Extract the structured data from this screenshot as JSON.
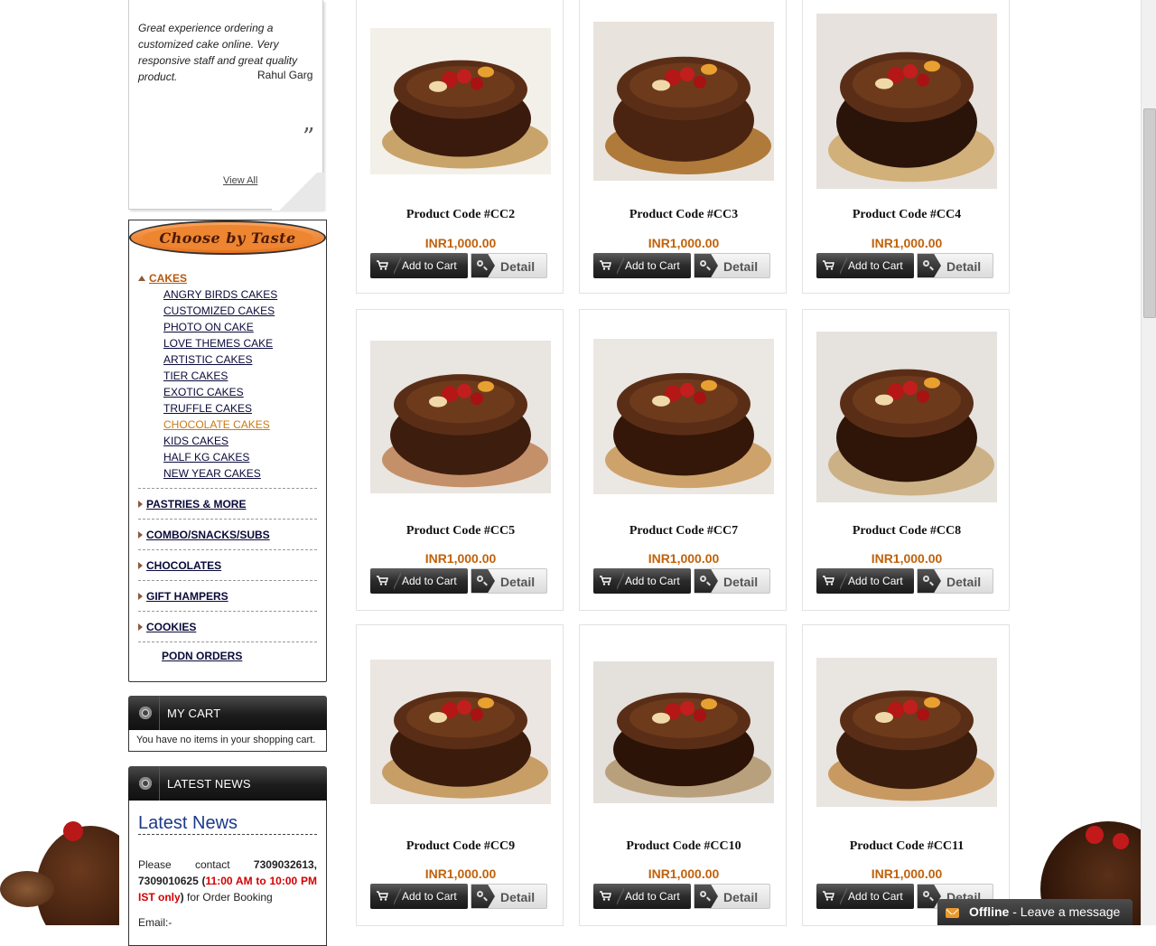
{
  "testimonial": {
    "text": "Great experience ordering a customized cake online. Very responsive staff and great quality product.",
    "author": "Rahul Garg",
    "view_all": "View All"
  },
  "taste": {
    "banner": "Choose by Taste",
    "categories": [
      {
        "label": "CAKES",
        "expanded": true,
        "subs": [
          "ANGRY BIRDS CAKES",
          "CUSTOMIZED CAKES",
          "PHOTO ON CAKE",
          "LOVE THEMES CAKE",
          "ARTISTIC CAKES",
          "TIER CAKES",
          "EXOTIC CAKES",
          "TRUFFLE CAKES",
          "CHOCOLATE CAKES",
          "KIDS CAKES",
          "HALF KG CAKES",
          "NEW YEAR CAKES"
        ],
        "current": "CHOCOLATE CAKES"
      },
      {
        "label": "PASTRIES & MORE"
      },
      {
        "label": "COMBO/SNACKS/SUBS"
      },
      {
        "label": "CHOCOLATES"
      },
      {
        "label": "GIFT HAMPERS"
      },
      {
        "label": "COOKIES"
      }
    ],
    "podn": "PODN ORDERS"
  },
  "cart": {
    "title": "MY CART",
    "empty_text": "You have no items in your shopping cart."
  },
  "news": {
    "header": "LATEST NEWS",
    "title": "Latest News",
    "contact_prefix": "Please contact",
    "phones": "7309032613, 7309010625",
    "hours_open": "(",
    "hours": "11:00 AM to 10:00 PM IST only",
    "hours_close": ")",
    "suffix": "for Order Booking",
    "email_label": "Email:-"
  },
  "buttons": {
    "add_to_cart": "Add to Cart",
    "detail": "Detail"
  },
  "products": [
    {
      "code": "Product Code #CC2",
      "price": "INR1,000.00"
    },
    {
      "code": "Product Code #CC3",
      "price": "INR1,000.00"
    },
    {
      "code": "Product Code #CC4",
      "price": "INR1,000.00"
    },
    {
      "code": "Product Code #CC5",
      "price": "INR1,000.00"
    },
    {
      "code": "Product Code #CC7",
      "price": "INR1,000.00"
    },
    {
      "code": "Product Code #CC8",
      "price": "INR1,000.00"
    },
    {
      "code": "Product Code #CC9",
      "price": "INR1,000.00"
    },
    {
      "code": "Product Code #CC10",
      "price": "INR1,000.00"
    },
    {
      "code": "Product Code #CC11",
      "price": "INR1,000.00"
    }
  ],
  "chat": {
    "status": "Offline",
    "message": " - Leave a message"
  },
  "colors": {
    "price": "#c0620b",
    "accent_orange": "#ee8530",
    "dark_panel": "#1c1c1c"
  }
}
